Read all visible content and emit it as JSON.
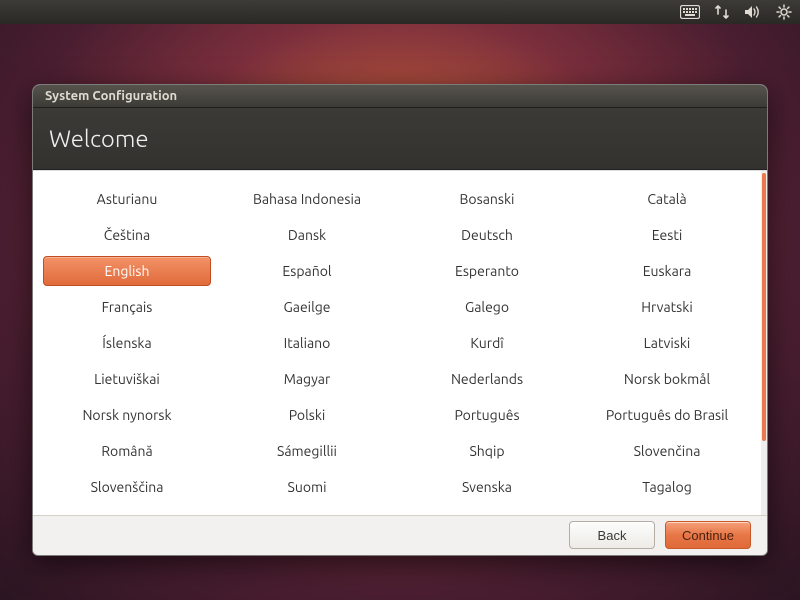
{
  "topbar": {
    "icons": [
      "keyboard-icon",
      "network-icon",
      "sound-icon",
      "settings-icon"
    ]
  },
  "titlebar": {
    "title": "System Configuration"
  },
  "header": {
    "heading": "Welcome"
  },
  "languages": [
    "Asturianu",
    "Bahasa Indonesia",
    "Bosanski",
    "Català",
    "Čeština",
    "Dansk",
    "Deutsch",
    "Eesti",
    "English",
    "Español",
    "Esperanto",
    "Euskara",
    "Français",
    "Gaeilge",
    "Galego",
    "Hrvatski",
    "Íslenska",
    "Italiano",
    "Kurdî",
    "Latviski",
    "Lietuviškai",
    "Magyar",
    "Nederlands",
    "Norsk bokmål",
    "Norsk nynorsk",
    "Polski",
    "Português",
    "Português do Brasil",
    "Română",
    "Sámegillii",
    "Shqip",
    "Slovenčina",
    "Slovenščina",
    "Suomi",
    "Svenska",
    "Tagalog"
  ],
  "selected_language": "English",
  "footer": {
    "back": "Back",
    "continue": "Continue"
  },
  "colors": {
    "accent": "#e77747",
    "panel": "#3c3b37"
  }
}
